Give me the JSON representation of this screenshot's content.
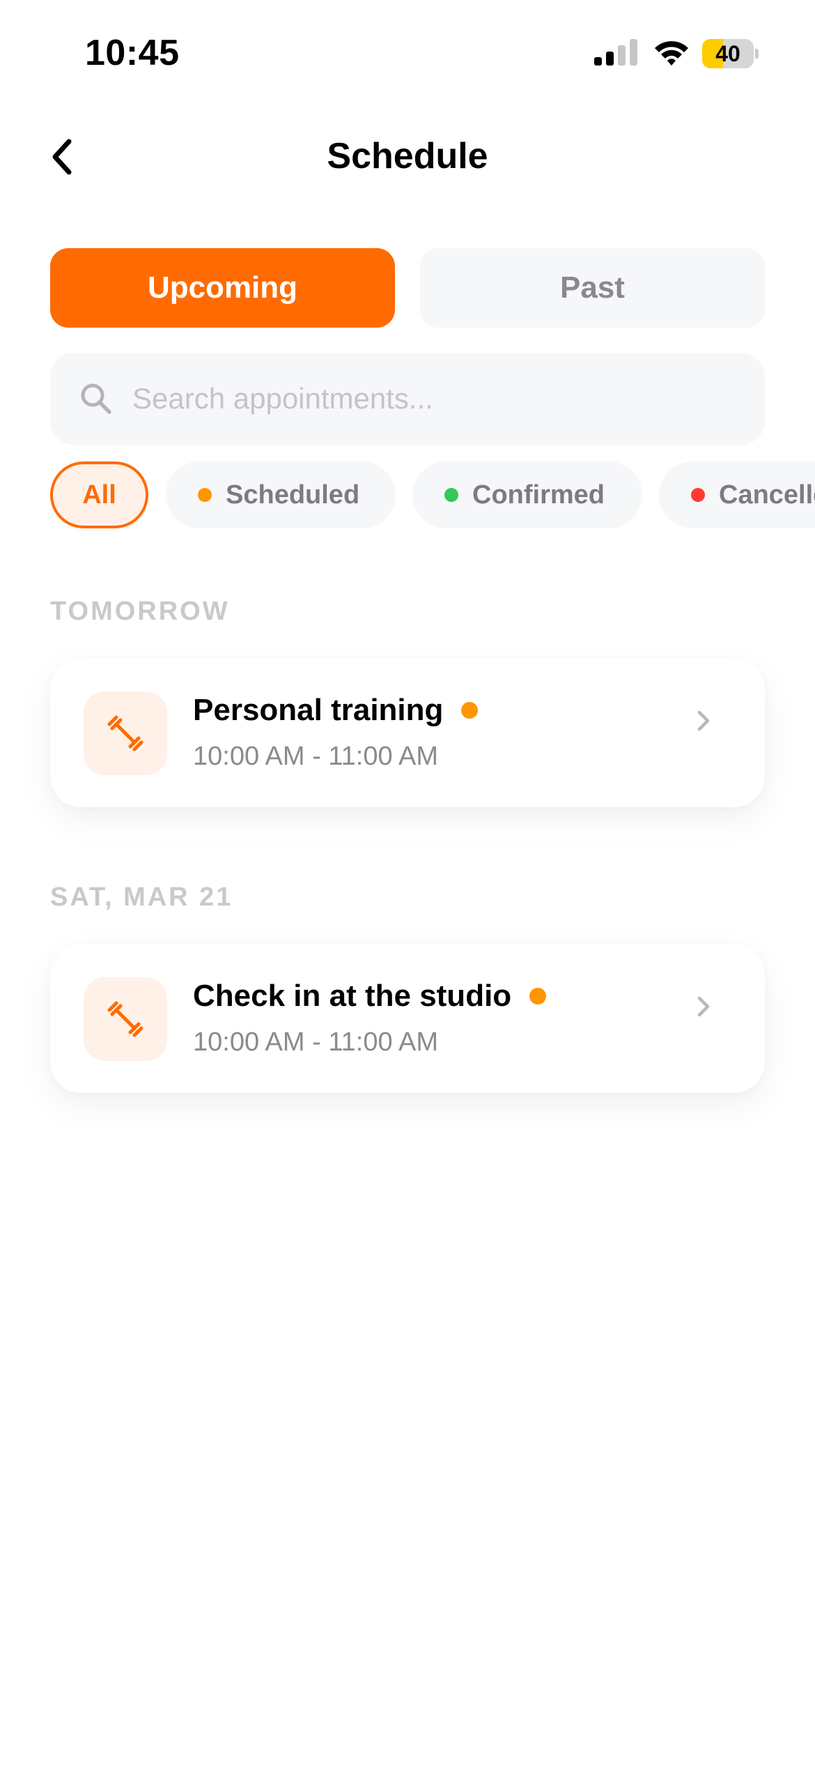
{
  "status_bar": {
    "time": "10:45",
    "battery_level": "40",
    "battery_fraction": 0.4,
    "battery_color": "#ffcc00",
    "signal_bars_active": 2,
    "signal_bars_total": 4
  },
  "header": {
    "title": "Schedule",
    "back_icon": "chevron-left-icon"
  },
  "tabs": [
    {
      "label": "Upcoming",
      "selected": true
    },
    {
      "label": "Past",
      "selected": false
    }
  ],
  "search": {
    "placeholder": "Search appointments...",
    "value": "",
    "icon": "search-icon"
  },
  "filters": [
    {
      "label": "All",
      "selected": true,
      "dot_color": ""
    },
    {
      "label": "Scheduled",
      "selected": false,
      "dot_color": "#ff9500"
    },
    {
      "label": "Confirmed",
      "selected": false,
      "dot_color": "#34c759"
    },
    {
      "label": "Cancelled",
      "selected": false,
      "dot_color": "#ff3b30"
    }
  ],
  "sections": [
    {
      "label": "TOMORROW",
      "appointments": [
        {
          "title": "Personal training",
          "time": "10:00 AM - 11:00 AM",
          "status_color": "#ff9500",
          "icon": "dumbbell-icon"
        }
      ]
    },
    {
      "label": "SAT, MAR 21",
      "appointments": [
        {
          "title": "Check in at the studio",
          "time": "10:00 AM - 11:00 AM",
          "status_color": "#ff9500",
          "icon": "dumbbell-icon"
        }
      ]
    }
  ],
  "colors": {
    "accent": "#ff6b00",
    "accent_soft": "#fff1e8",
    "surface": "#f6f7f9",
    "muted_text": "#8a8a8e"
  }
}
